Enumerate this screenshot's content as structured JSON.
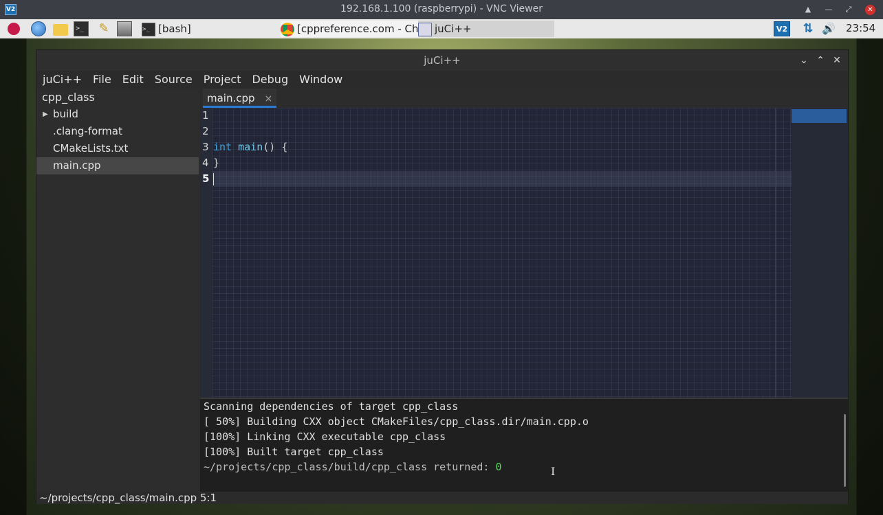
{
  "vnc": {
    "title": "192.168.1.100 (raspberrypi) - VNC Viewer",
    "logo": "V2",
    "controls": [
      "▲",
      "—",
      "⤢",
      "✕"
    ]
  },
  "taskbar": {
    "launchers": [
      "raspberry-menu-icon",
      "web-browser-icon",
      "file-manager-icon",
      "terminal-icon",
      "text-editor-icon",
      "system-monitor-icon"
    ],
    "tasks": [
      {
        "label": "[bash]",
        "icon": "terminal-icon"
      },
      {
        "label": "[cppreference.com - Ch...",
        "icon": "chromium-icon"
      },
      {
        "label": "juCi++",
        "icon": "window-icon"
      }
    ],
    "tray": {
      "vnc": "V2",
      "network": "⇅",
      "volume": "🔊",
      "clock": "23:54"
    }
  },
  "window": {
    "title": "juCi++",
    "menu": [
      "juCi++",
      "File",
      "Edit",
      "Source",
      "Project",
      "Debug",
      "Window"
    ],
    "sidebar": {
      "root": "cpp_class",
      "items": [
        {
          "label": "build",
          "expandable": true
        },
        {
          "label": ".clang-format"
        },
        {
          "label": "CMakeLists.txt"
        },
        {
          "label": "main.cpp",
          "selected": true
        }
      ]
    },
    "tab": {
      "label": "main.cpp",
      "close": "×"
    },
    "editor": {
      "line_numbers": [
        "1",
        "2",
        "3",
        "4",
        "5"
      ],
      "code": {
        "line3_kw": "int",
        "line3_fn": "main",
        "line3_rest": "() {",
        "line4": "}"
      }
    },
    "terminal": {
      "lines": [
        "Scanning dependencies of target cpp_class",
        "[ 50%] Building CXX object CMakeFiles/cpp_class.dir/main.cpp.o",
        "[100%] Linking CXX executable cpp_class",
        "[100%] Built target cpp_class"
      ],
      "return_prefix": "~/projects/cpp_class/build/cpp_class returned: ",
      "return_code": "0"
    },
    "status": "~/projects/cpp_class/main.cpp 5:1"
  }
}
